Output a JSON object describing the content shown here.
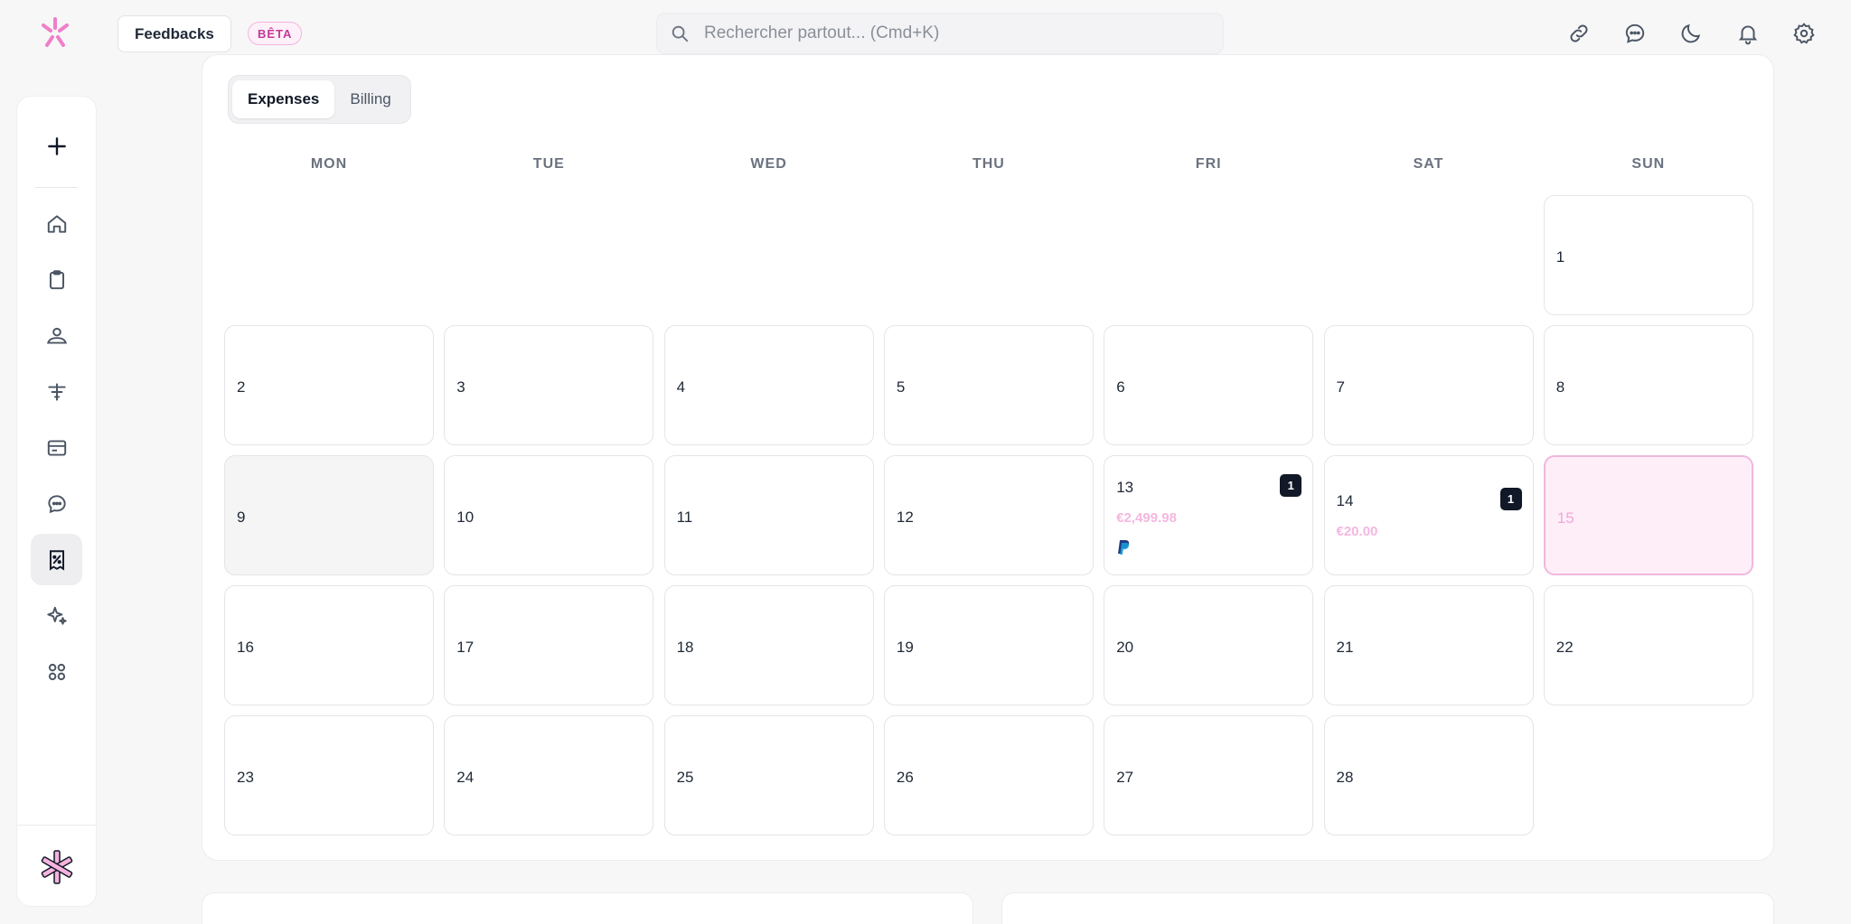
{
  "app": {
    "accent_color": "#e94fb4"
  },
  "header": {
    "feedback_label": "Feedbacks",
    "beta_label": "BÊTA",
    "search_placeholder": "Rechercher partout... (Cmd+K)",
    "icons": [
      "link-icon",
      "chat-icon",
      "moon-icon",
      "bell-icon",
      "gear-icon"
    ]
  },
  "sidebar": {
    "items": [
      "plus-icon",
      "home-icon",
      "clipboard-icon",
      "team-icon",
      "filter-icon",
      "card-icon",
      "message-icon",
      "receipt-icon",
      "sparkle-icon",
      "apps-icon"
    ],
    "active": "receipt-icon"
  },
  "tabs": {
    "expenses": "Expenses",
    "billing": "Billing",
    "active": "Expenses"
  },
  "calendar": {
    "weekdays": [
      "MON",
      "TUE",
      "WED",
      "THU",
      "FRI",
      "SAT",
      "SUN"
    ],
    "days": [
      {
        "d": "1",
        "col": 6,
        "row": 0
      },
      {
        "d": "2",
        "col": 0,
        "row": 1
      },
      {
        "d": "3",
        "col": 1,
        "row": 1
      },
      {
        "d": "4",
        "col": 2,
        "row": 1
      },
      {
        "d": "5",
        "col": 3,
        "row": 1
      },
      {
        "d": "6",
        "col": 4,
        "row": 1
      },
      {
        "d": "7",
        "col": 5,
        "row": 1
      },
      {
        "d": "8",
        "col": 6,
        "row": 1
      },
      {
        "d": "9",
        "col": 0,
        "row": 2,
        "gray": true
      },
      {
        "d": "10",
        "col": 1,
        "row": 2
      },
      {
        "d": "11",
        "col": 2,
        "row": 2
      },
      {
        "d": "12",
        "col": 3,
        "row": 2
      },
      {
        "d": "13",
        "col": 4,
        "row": 2,
        "count": "1",
        "amount": "€2,499.98",
        "paypal": true
      },
      {
        "d": "14",
        "col": 5,
        "row": 2,
        "count": "1",
        "amount": "€20.00"
      },
      {
        "d": "15",
        "col": 6,
        "row": 2,
        "today": true
      },
      {
        "d": "16",
        "col": 0,
        "row": 3
      },
      {
        "d": "17",
        "col": 1,
        "row": 3
      },
      {
        "d": "18",
        "col": 2,
        "row": 3
      },
      {
        "d": "19",
        "col": 3,
        "row": 3
      },
      {
        "d": "20",
        "col": 4,
        "row": 3
      },
      {
        "d": "21",
        "col": 5,
        "row": 3
      },
      {
        "d": "22",
        "col": 6,
        "row": 3
      },
      {
        "d": "23",
        "col": 0,
        "row": 4
      },
      {
        "d": "24",
        "col": 1,
        "row": 4
      },
      {
        "d": "25",
        "col": 2,
        "row": 4
      },
      {
        "d": "26",
        "col": 3,
        "row": 4
      },
      {
        "d": "27",
        "col": 4,
        "row": 4
      },
      {
        "d": "28",
        "col": 5,
        "row": 4
      }
    ]
  }
}
